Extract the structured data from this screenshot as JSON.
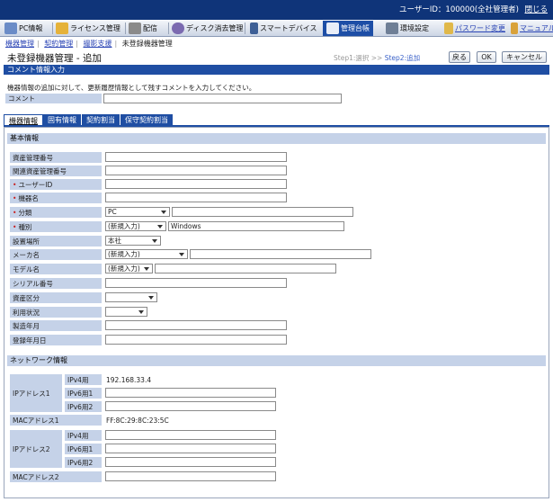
{
  "header": {
    "user": "ユーザーID：100000(全社管理者)",
    "logout": "閉じる"
  },
  "nav": {
    "items": [
      "PC情報",
      "ライセンス管理",
      "配信",
      "ディスク消去管理",
      "スマートデバイス",
      "管理台帳",
      "環境設定"
    ],
    "password": "パスワード変更",
    "manual": "マニュアル"
  },
  "breadcrumb": {
    "items": [
      "機器管理",
      "契約管理",
      "撮影支援"
    ],
    "current": "未登録機器管理"
  },
  "page": {
    "title": "未登録機器管理 - 追加",
    "step1": "Step1:選択 >>",
    "step2": "Step2:追加",
    "back": "戻る",
    "ok": "OK",
    "cancel": "キャンセル"
  },
  "comment": {
    "section": "コメント情報入力",
    "note": "機器情報の追加に対して、更新履歴情報として残すコメントを入力してください。",
    "label": "コメント",
    "value": ""
  },
  "tabs": [
    "機器情報",
    "固有情報",
    "契約割当",
    "保守契約割当"
  ],
  "basic": {
    "heading": "基本情報",
    "fields": {
      "asset_no": "資産管理番号",
      "related_asset_no": "関連資産管理番号",
      "user_id": "ユーザーID",
      "device_name": "機器名",
      "category": "分類",
      "category_value": "PC",
      "kind": "種別",
      "kind_value": "(新規入力)",
      "kind_text": "Windows",
      "location": "設置場所",
      "location_value": "本社",
      "maker": "メーカ名",
      "maker_value": "(新規入力)",
      "model": "モデル名",
      "model_value": "(新規入力)",
      "serial": "シリアル番号",
      "asset_class": "資産区分",
      "usage": "利用状況",
      "mfg_date": "製造年月",
      "reg_date": "登録年月日"
    }
  },
  "network": {
    "heading": "ネットワーク情報",
    "ip1": "IPアドレス1",
    "ip2": "IPアドレス2",
    "ipv4": "IPv4用",
    "ipv6_1": "IPv6用1",
    "ipv6_2": "IPv6用2",
    "ip1_v4_value": "192.168.33.4",
    "mac1": "MACアドレス1",
    "mac1_value": "FF:8C:29:8C:23:5C",
    "mac2": "MACアドレス2"
  },
  "colors": {
    "topbar": "#0f3479",
    "accent": "#1f4ea3",
    "label_bg": "#c5d2e8",
    "required": "#c81e1e"
  }
}
